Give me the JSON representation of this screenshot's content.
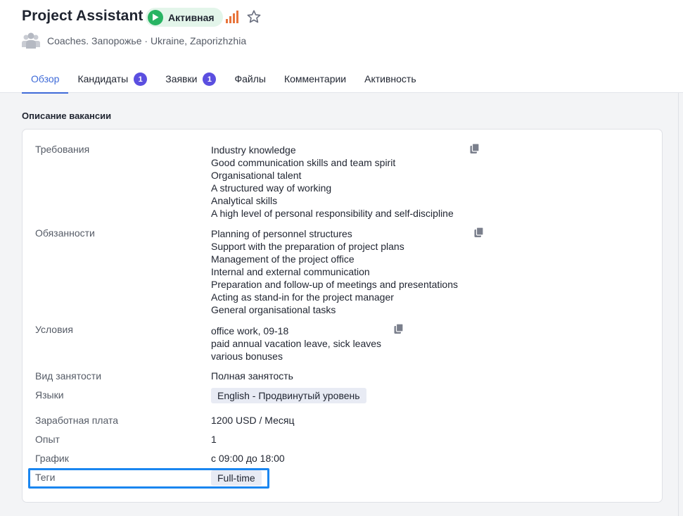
{
  "header": {
    "title": "Project Assistant",
    "status": "Активная",
    "subtitle": "Coaches. Запорожье · Ukraine, Zaporizhzhia",
    "status_color": "#28b463",
    "priority_color": "#e8743b"
  },
  "tabs": [
    {
      "label": "Обзор",
      "count": null
    },
    {
      "label": "Кандидаты",
      "count": "1"
    },
    {
      "label": "Заявки",
      "count": "1"
    },
    {
      "label": "Файлы",
      "count": null
    },
    {
      "label": "Комментарии",
      "count": null
    },
    {
      "label": "Активность",
      "count": null
    }
  ],
  "section": {
    "title": "Описание вакансии"
  },
  "fields": {
    "requirements": {
      "label": "Требования",
      "lines": [
        "Industry knowledge",
        "Good communication skills and team spirit",
        "Organisational talent",
        "A structured way of working",
        "Analytical skills",
        "A high level of personal responsibility and self-discipline"
      ]
    },
    "duties": {
      "label": "Обязанности",
      "lines": [
        "Planning of personnel structures",
        "Support with the preparation of project plans",
        "Management of the project office",
        "Internal and external communication",
        "Preparation and follow-up of meetings and presentations",
        "Acting as stand-in for the project manager",
        "General organisational tasks"
      ]
    },
    "conditions": {
      "label": "Условия",
      "lines": [
        "office work, 09-18",
        "paid annual vacation leave, sick leaves",
        "various bonuses"
      ]
    },
    "employment": {
      "label": "Вид занятости",
      "value": "Полная занятость"
    },
    "languages": {
      "label": "Языки",
      "value": "English - Продвинутый уровень"
    },
    "salary": {
      "label": "Заработная плата",
      "value": "1200 USD / Месяц"
    },
    "experience": {
      "label": "Опыт",
      "value": "1"
    },
    "schedule": {
      "label": "График",
      "value": "с 09:00 до 18:00"
    },
    "tags": {
      "label": "Теги",
      "value": "Full-time"
    }
  }
}
